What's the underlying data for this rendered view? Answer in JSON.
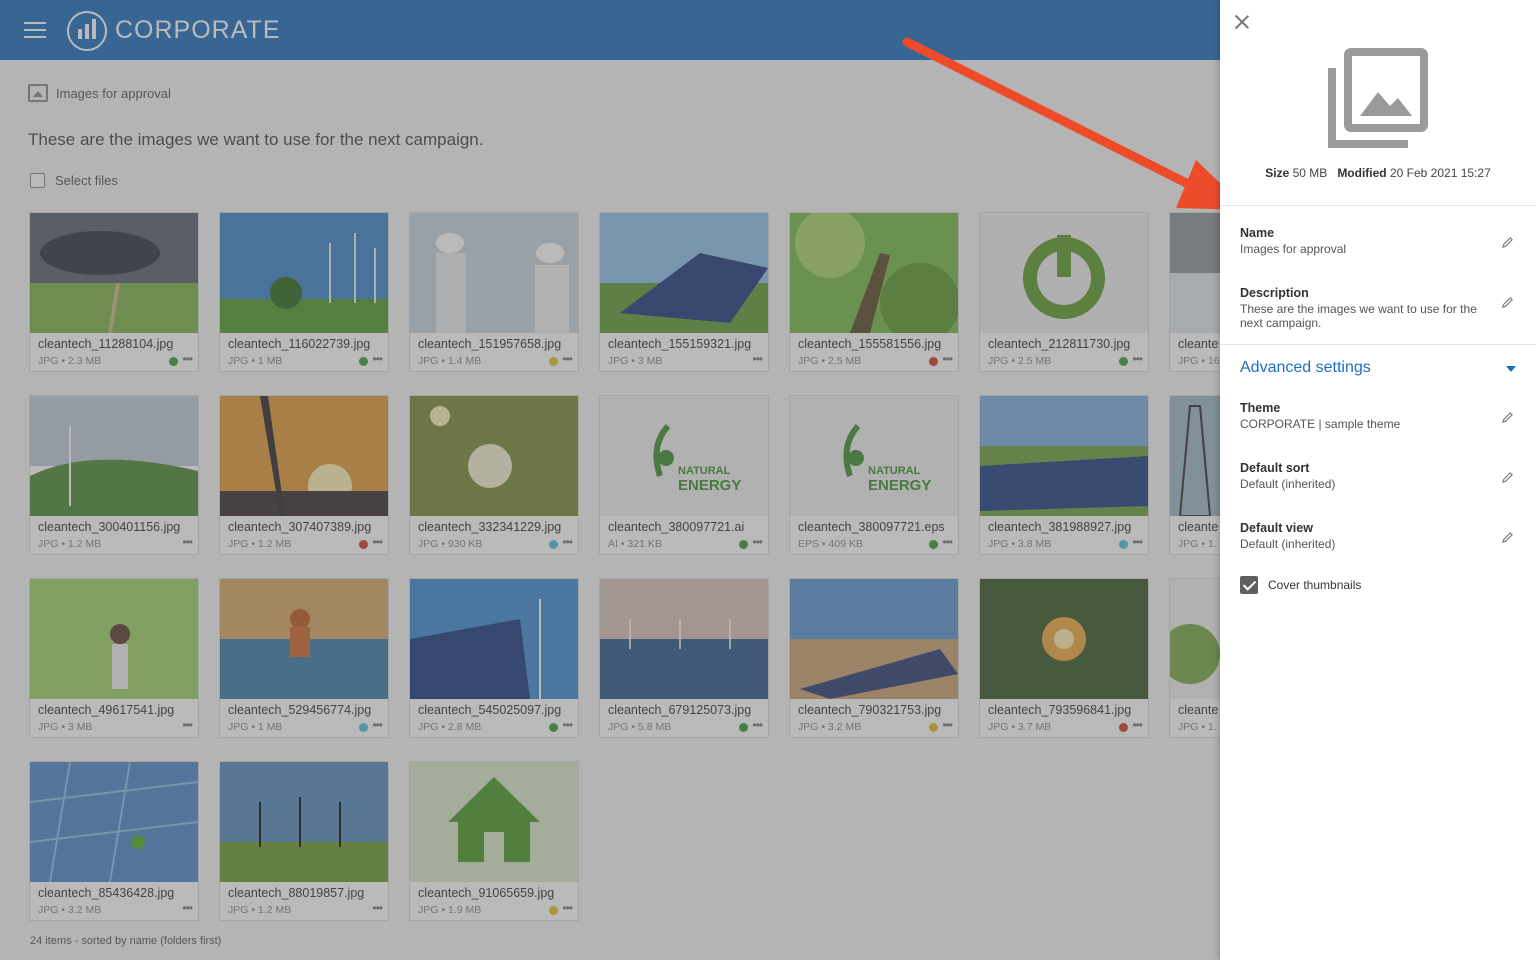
{
  "header": {
    "brand": "CORPORATE"
  },
  "folder": {
    "name": "Images for approval",
    "description": "These are the images we want to use for the next campaign.",
    "select_label": "Select files",
    "footer": "24 items - sorted by name (folders first)"
  },
  "status_colors": {
    "green": "#3a9b3a",
    "red": "#d23a2a",
    "yellow": "#e3c21f",
    "cyan": "#4cc0d8"
  },
  "files": [
    {
      "name": "cleantech_11288104.jpg",
      "meta": "JPG • 2.3 MB",
      "status": "green",
      "icon": "storm-field-turbine"
    },
    {
      "name": "cleantech_116022739.jpg",
      "meta": "JPG • 1 MB",
      "status": "green",
      "icon": "tree-turbines"
    },
    {
      "name": "cleantech_151957658.jpg",
      "meta": "JPG • 1.4 MB",
      "status": "yellow",
      "icon": "engineers"
    },
    {
      "name": "cleantech_155159321.jpg",
      "meta": "JPG • 3 MB",
      "status": "",
      "icon": "solar-panel"
    },
    {
      "name": "cleantech_155581556.jpg",
      "meta": "JPG • 2.5 MB",
      "status": "red",
      "icon": "tree-canopy"
    },
    {
      "name": "cleantech_212811730.jpg",
      "meta": "JPG • 2.5 MB",
      "status": "green",
      "icon": "power-symbol"
    },
    {
      "name": "cleante",
      "meta": "JPG • 16",
      "status": "",
      "icon": "dam"
    },
    {
      "name": "cleantech_300401156.jpg",
      "meta": "JPG • 1.2 MB",
      "status": "",
      "icon": "hills-turbines"
    },
    {
      "name": "cleantech_307407389.jpg",
      "meta": "JPG • 1.2 MB",
      "status": "red",
      "icon": "sunset-turbine"
    },
    {
      "name": "cleantech_332341229.jpg",
      "meta": "JPG • 930 KB",
      "status": "cyan",
      "icon": "light-bulb"
    },
    {
      "name": "cleantech_380097721.ai",
      "meta": "AI • 321 KB",
      "status": "green",
      "icon": "natural-energy-logo"
    },
    {
      "name": "cleantech_380097721.eps",
      "meta": "EPS • 409 KB",
      "status": "green",
      "icon": "natural-energy-logo"
    },
    {
      "name": "cleantech_381988927.jpg",
      "meta": "JPG • 3.8 MB",
      "status": "cyan",
      "icon": "solar-field"
    },
    {
      "name": "cleante",
      "meta": "JPG • 1.",
      "status": "",
      "icon": "power-tower"
    },
    {
      "name": "cleantech_49617541.jpg",
      "meta": "JPG • 3 MB",
      "status": "",
      "icon": "woman-forest"
    },
    {
      "name": "cleantech_529456774.jpg",
      "meta": "JPG • 1 MB",
      "status": "cyan",
      "icon": "solar-worker"
    },
    {
      "name": "cleantech_545025097.jpg",
      "meta": "JPG • 2.8 MB",
      "status": "green",
      "icon": "solar-turbine-sky"
    },
    {
      "name": "cleantech_679125073.jpg",
      "meta": "JPG • 5.8 MB",
      "status": "green",
      "icon": "offshore-wind"
    },
    {
      "name": "cleantech_790321753.jpg",
      "meta": "JPG • 3.2 MB",
      "status": "yellow",
      "icon": "desert-solar"
    },
    {
      "name": "cleantech_793596841.jpg",
      "meta": "JPG • 3.7 MB",
      "status": "red",
      "icon": "hands-bulb"
    },
    {
      "name": "cleante",
      "meta": "JPG • 1.",
      "status": "",
      "icon": "flower-earth"
    },
    {
      "name": "cleantech_85436428.jpg",
      "meta": "JPG • 3.2 MB",
      "status": "",
      "icon": "solar-array"
    },
    {
      "name": "cleantech_88019857.jpg",
      "meta": "JPG • 1.2 MB",
      "status": "",
      "icon": "turbines-field"
    },
    {
      "name": "cleantech_91065659.jpg",
      "meta": "JPG • 1.9 MB",
      "status": "yellow",
      "icon": "grass-house"
    }
  ],
  "panel": {
    "size_label": "Size",
    "size_value": "50 MB",
    "modified_label": "Modified",
    "modified_value": "20 Feb 2021 15:27",
    "name_label": "Name",
    "name_value": "Images for approval",
    "description_label": "Description",
    "description_value": "These are the images we want to use for the next campaign.",
    "advanced_label": "Advanced settings",
    "theme_label": "Theme",
    "theme_value": "CORPORATE | sample theme",
    "sort_label": "Default sort",
    "sort_value": "Default (inherited)",
    "view_label": "Default view",
    "view_value": "Default (inherited)",
    "cover_label": "Cover thumbnails"
  },
  "annotation": {
    "arrow_color": "#ee4b2b"
  }
}
